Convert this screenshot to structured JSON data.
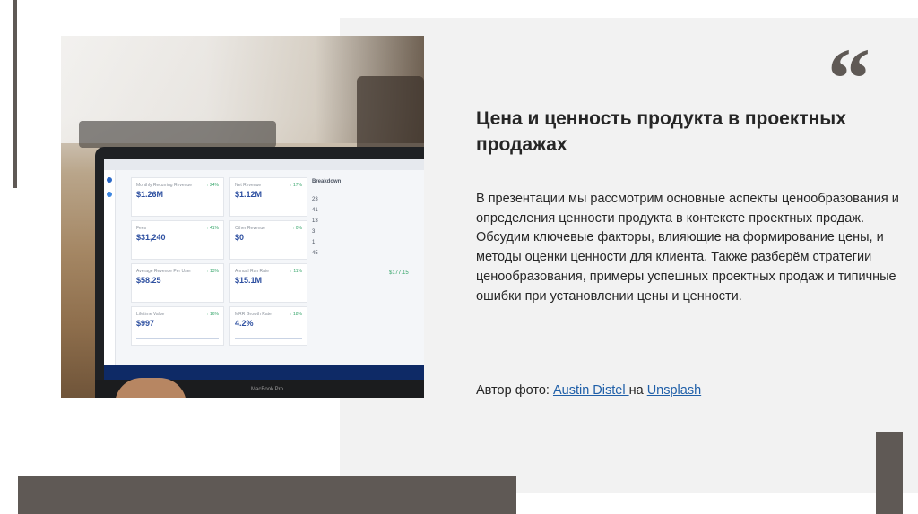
{
  "slide": {
    "title": "Цена и ценность продукта в проектных продажах",
    "body": "В презентации мы рассмотрим основные аспекты ценообразования и определения ценности продукта в контексте проектных продаж. Обсудим ключевые факторы, влияющие на формирование цены, и методы оценки ценности для клиента. Также разберём стратегии ценообразования, примеры успешных проектных продаж и типичные ошибки при установлении цены и ценности.",
    "quote_glyph": "“",
    "credit": {
      "prefix": "Автор фото: ",
      "author": "Austin Distel ",
      "middle": "на ",
      "source": "Unsplash"
    }
  },
  "photo": {
    "icon": "laptop-dashboard-photo",
    "screen": {
      "cards": [
        {
          "label": "Monthly Recurring Revenue",
          "value": "$1.26M",
          "change": "↑ 24%"
        },
        {
          "label": "Net Revenue",
          "value": "$1.12M",
          "change": "↑ 17%"
        },
        {
          "label": "Fees",
          "value": "$31,240",
          "change": "↑ 41%"
        },
        {
          "label": "Other Revenue",
          "value": "$0",
          "change": "↑ 0%"
        },
        {
          "label": "Average Revenue Per User",
          "value": "$58.25",
          "change": "↑ 13%"
        },
        {
          "label": "Annual Run Rate",
          "value": "$15.1M",
          "change": "↑ 11%"
        },
        {
          "label": "Lifetime Value",
          "value": "$997",
          "change": "↑ 16%"
        },
        {
          "label": "MRR Growth Rate",
          "value": "4.2%",
          "change": "↑ 18%"
        }
      ],
      "breakdown_title": "Breakdown",
      "breakdown": [
        "23",
        "41",
        "13",
        "3",
        "1",
        "45"
      ],
      "total": "$177.15",
      "brand": "MacBook Pro"
    }
  },
  "colors": {
    "accent": "#5f5955",
    "panel": "#f2f2f2",
    "link": "#1f5fa8",
    "text": "#262626"
  }
}
